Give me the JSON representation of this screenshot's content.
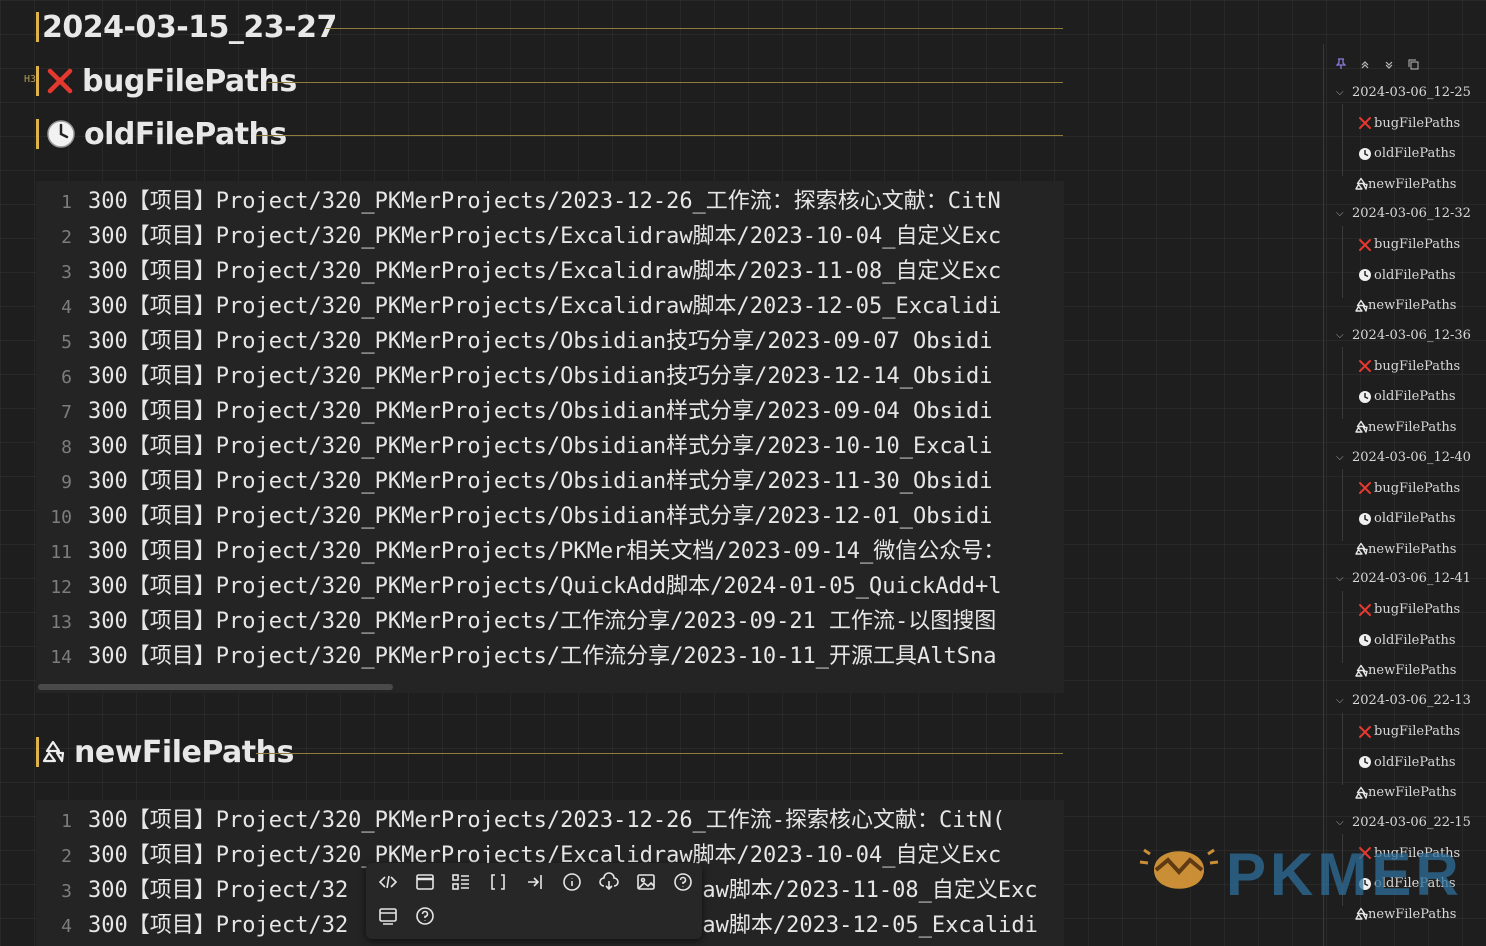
{
  "headings": {
    "h1": "2024-03-15_23-27",
    "h3tag": "H3",
    "bug": "bugFilePaths",
    "old": "oldFilePaths",
    "new": "newFilePaths"
  },
  "block1": [
    {
      "n": "1",
      "t": "300【项目】Project/320_PKMerProjects/2023-12-26_工作流：探索核心文献：CitN"
    },
    {
      "n": "2",
      "t": "300【项目】Project/320_PKMerProjects/Excalidraw脚本/2023-10-04_自定义Exc"
    },
    {
      "n": "3",
      "t": "300【项目】Project/320_PKMerProjects/Excalidraw脚本/2023-11-08_自定义Exc"
    },
    {
      "n": "4",
      "t": "300【项目】Project/320_PKMerProjects/Excalidraw脚本/2023-12-05_Excalidi"
    },
    {
      "n": "5",
      "t": "300【项目】Project/320_PKMerProjects/Obsidian技巧分享/2023-09-07 Obsidi"
    },
    {
      "n": "6",
      "t": "300【项目】Project/320_PKMerProjects/Obsidian技巧分享/2023-12-14_Obsidi"
    },
    {
      "n": "7",
      "t": "300【项目】Project/320_PKMerProjects/Obsidian样式分享/2023-09-04 Obsidi"
    },
    {
      "n": "8",
      "t": "300【项目】Project/320_PKMerProjects/Obsidian样式分享/2023-10-10_Excali"
    },
    {
      "n": "9",
      "t": "300【项目】Project/320_PKMerProjects/Obsidian样式分享/2023-11-30_Obsidi"
    },
    {
      "n": "10",
      "t": "300【项目】Project/320_PKMerProjects/Obsidian样式分享/2023-12-01_Obsidi"
    },
    {
      "n": "11",
      "t": "300【项目】Project/320_PKMerProjects/PKMer相关文档/2023-09-14_微信公众号："
    },
    {
      "n": "12",
      "t": "300【项目】Project/320_PKMerProjects/QuickAdd脚本/2024-01-05_QuickAdd+l"
    },
    {
      "n": "13",
      "t": "300【项目】Project/320_PKMerProjects/工作流分享/2023-09-21 工作流-以图搜图"
    },
    {
      "n": "14",
      "t": "300【项目】Project/320_PKMerProjects/工作流分享/2023-10-11_开源工具AltSna"
    }
  ],
  "block2": [
    {
      "n": "1",
      "t": "300【项目】Project/320_PKMerProjects/2023-12-26_工作流-探索核心文献：CitN("
    },
    {
      "n": "2",
      "t": "300【项目】Project/320_PKMerProjects/Excalidraw脚本/2023-10-04_自定义Exc"
    },
    {
      "n": "3",
      "t": "300【项目】Project/32",
      "t2": "raw脚本/2023-11-08_自定义Exc"
    },
    {
      "n": "4",
      "t": "300【项目】Project/32",
      "t2": "raw脚本/2023-12-05_Excalidi"
    }
  ],
  "toolbar": {
    "icons": [
      "code-icon",
      "window-icon",
      "list-layout-icon",
      "brackets-icon",
      "insert-icon",
      "info-icon",
      "cloud-sync-icon",
      "image-icon",
      "help-icon",
      "card-icon",
      "help-icon-2"
    ]
  },
  "outline": {
    "tool_icons": [
      "pin-icon",
      "expand-all-icon",
      "collapse-all-icon",
      "copy-icon"
    ],
    "groups": [
      {
        "date": "2024-03-06_12-25",
        "items": [
          "bugFilePaths",
          "oldFilePaths",
          "newFilePaths"
        ]
      },
      {
        "date": "2024-03-06_12-32",
        "items": [
          "bugFilePaths",
          "oldFilePaths",
          "newFilePaths"
        ]
      },
      {
        "date": "2024-03-06_12-36",
        "items": [
          "bugFilePaths",
          "oldFilePaths",
          "newFilePaths"
        ]
      },
      {
        "date": "2024-03-06_12-40",
        "items": [
          "bugFilePaths",
          "oldFilePaths",
          "newFilePaths"
        ]
      },
      {
        "date": "2024-03-06_12-41",
        "items": [
          "bugFilePaths",
          "oldFilePaths",
          "newFilePaths"
        ]
      },
      {
        "date": "2024-03-06_22-13",
        "items": [
          "bugFilePaths",
          "oldFilePaths",
          "newFilePaths"
        ]
      },
      {
        "date": "2024-03-06_22-15",
        "items": [
          "bugFilePaths",
          "oldFilePaths",
          "newFilePaths"
        ]
      }
    ]
  },
  "watermark": {
    "text": "PKMER"
  },
  "colors": {
    "accent": "#e0b24a",
    "bug": "#e5392f",
    "bg": "#1e1e1e"
  }
}
